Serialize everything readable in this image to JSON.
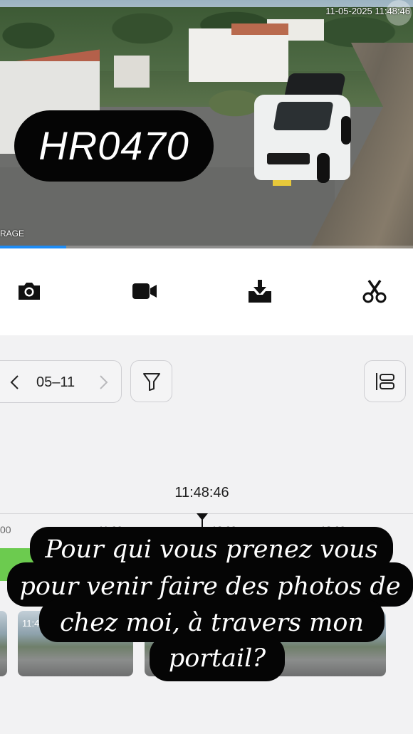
{
  "feed": {
    "timestamp": "11-05-2025 11:48:46",
    "label": "RAGE",
    "progress_fraction": 0.16
  },
  "sticker": {
    "plate_text": "HR0470"
  },
  "toolbar": {
    "items": [
      {
        "name": "snapshot",
        "icon": "camera-icon"
      },
      {
        "name": "record",
        "icon": "video-icon"
      },
      {
        "name": "download",
        "icon": "download-icon"
      },
      {
        "name": "clip",
        "icon": "scissors-icon"
      }
    ]
  },
  "date_nav": {
    "date": "05–11",
    "prev_icon": "chevron-left-icon",
    "next_icon": "chevron-right-icon"
  },
  "filter": {
    "icon": "filter-icon"
  },
  "view_toggle": {
    "icon": "layout-list-icon"
  },
  "timeline": {
    "current_time": "11:48:46",
    "tick_labels": [
      "00",
      "11:00",
      "12:00",
      "12:00"
    ],
    "recording_color": "#6ccb4f"
  },
  "thumbnails": [
    {
      "time": ""
    },
    {
      "time": "11:4"
    },
    {
      "time": ""
    },
    {
      "time": ""
    }
  ],
  "caption": {
    "lines": [
      "Pour qui vous prenez vous",
      "pour venir faire des photos de",
      "chez moi, à travers mon",
      "portail?"
    ]
  },
  "colors": {
    "accent": "#1e8cf5",
    "recording": "#6ccb4f"
  }
}
